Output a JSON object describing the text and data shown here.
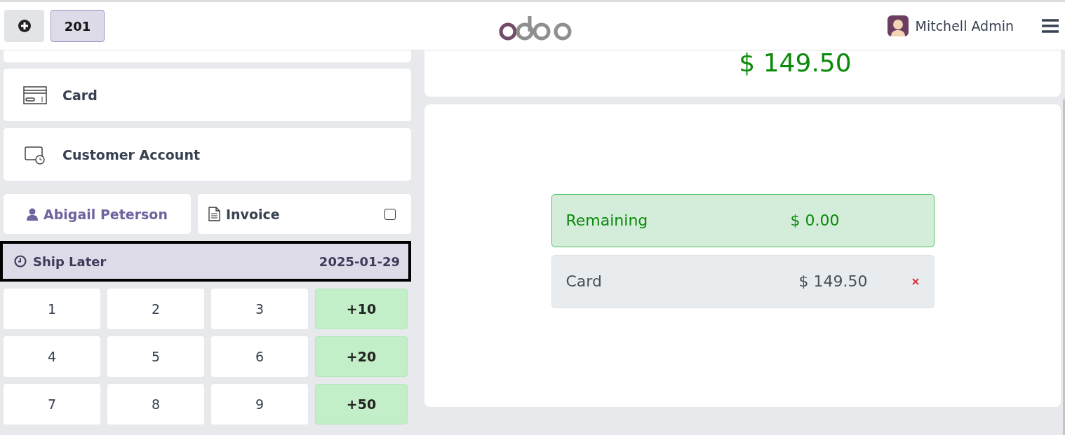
{
  "header": {
    "order_tab": {
      "label": "201",
      "selected": true
    },
    "user": {
      "name": "Mitchell Admin"
    }
  },
  "payment_methods": [
    {
      "label": "Card",
      "kind": "card"
    },
    {
      "label": "Customer Account",
      "kind": "account"
    }
  ],
  "partner": {
    "name": "Abigail Peterson"
  },
  "invoice": {
    "label": "Invoice",
    "checked": false
  },
  "ship_later": {
    "label": "Ship Later",
    "date": "2025-01-29"
  },
  "numpad": [
    {
      "label": "1",
      "kind": "digit"
    },
    {
      "label": "2",
      "kind": "digit"
    },
    {
      "label": "3",
      "kind": "digit"
    },
    {
      "label": "+10",
      "kind": "add"
    },
    {
      "label": "4",
      "kind": "digit"
    },
    {
      "label": "5",
      "kind": "digit"
    },
    {
      "label": "6",
      "kind": "digit"
    },
    {
      "label": "+20",
      "kind": "add"
    },
    {
      "label": "7",
      "kind": "digit"
    },
    {
      "label": "8",
      "kind": "digit"
    },
    {
      "label": "9",
      "kind": "digit"
    },
    {
      "label": "+50",
      "kind": "add"
    }
  ],
  "total": "$ 149.50",
  "remaining": {
    "label": "Remaining",
    "amount": "$ 0.00"
  },
  "payment_lines": [
    {
      "method": "Card",
      "amount": "$ 149.50"
    }
  ]
}
